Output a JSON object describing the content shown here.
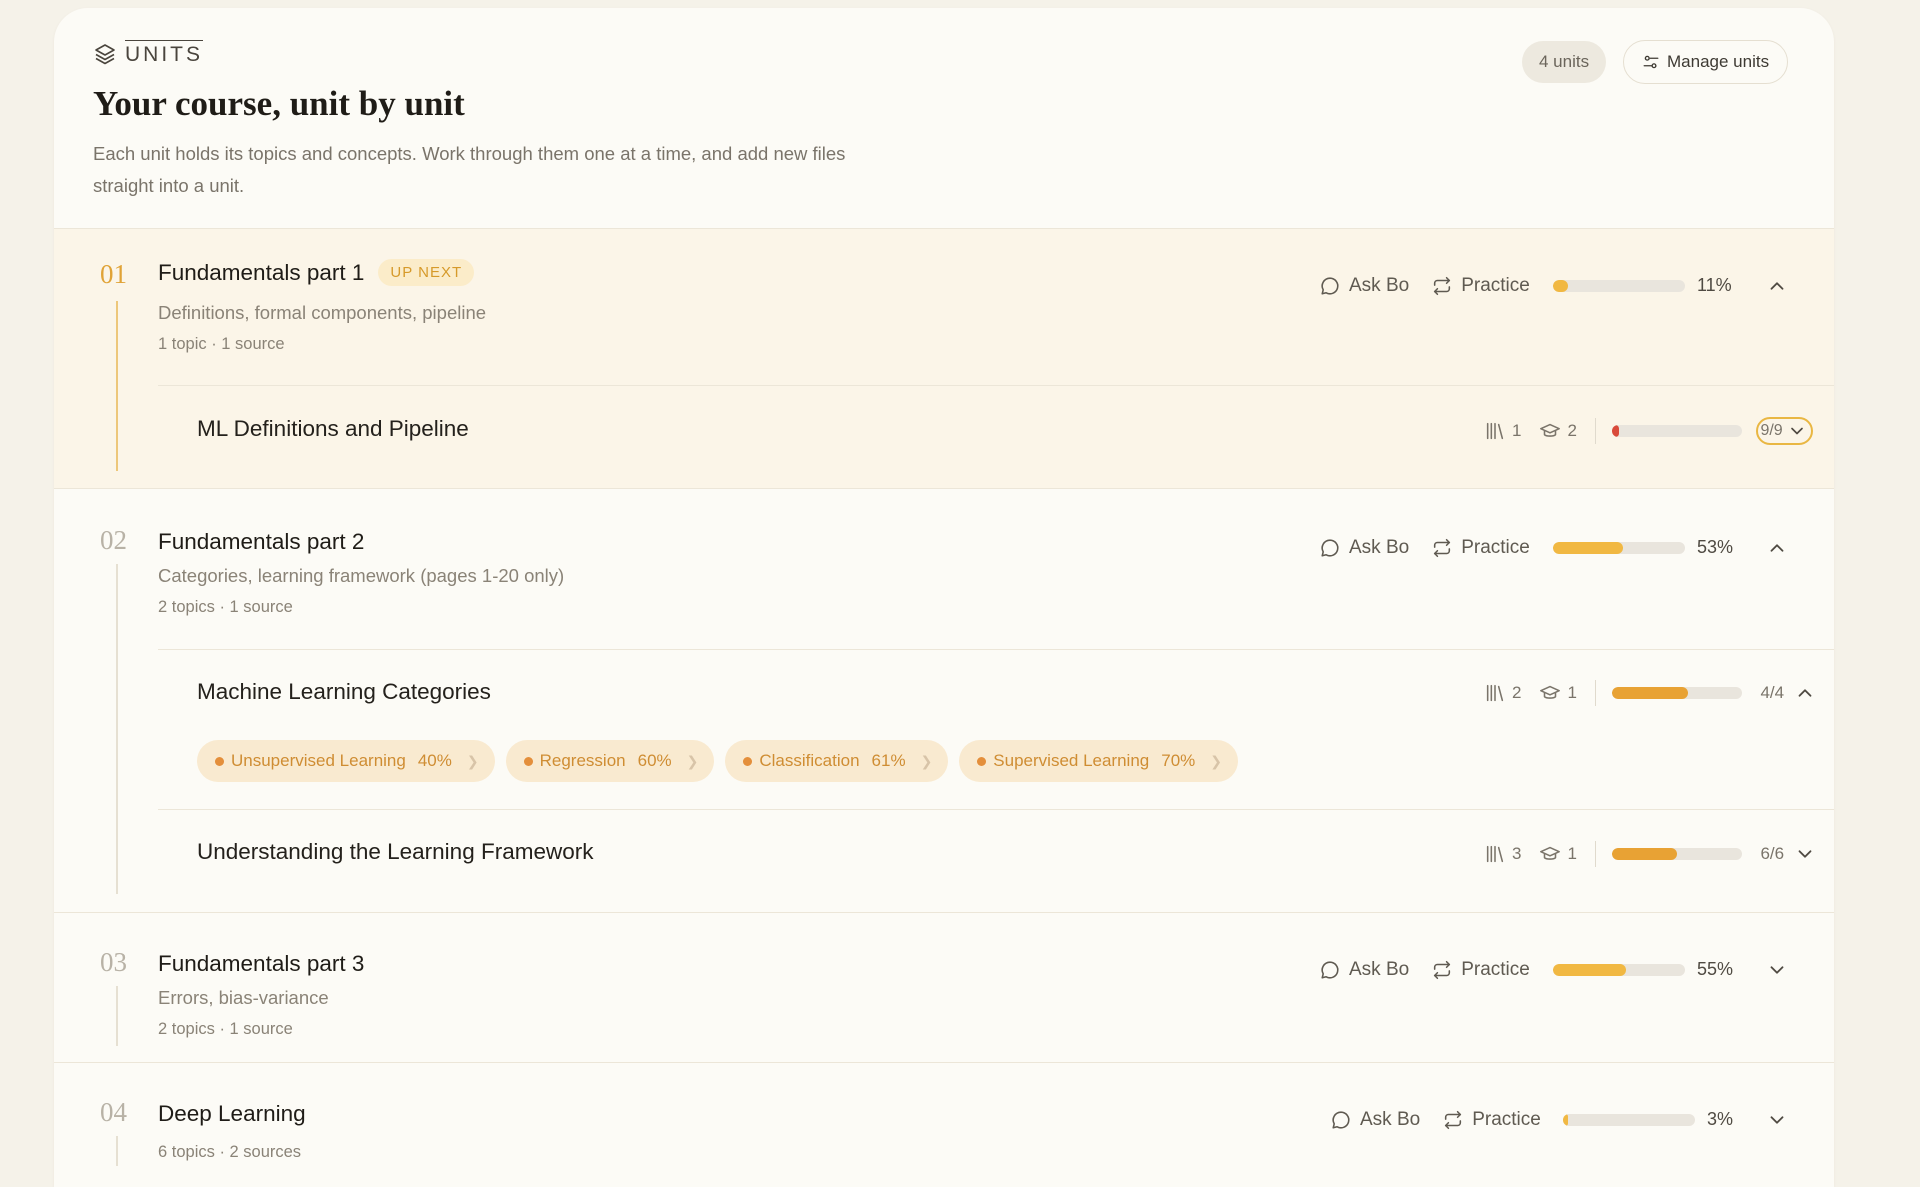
{
  "header": {
    "eyebrow": "UNITS",
    "title": "Your course, unit by unit",
    "description": "Each unit holds its topics and concepts. Work through them one at a time, and add new files straight into a unit.",
    "unit_count": "4 units",
    "manage_label": "Manage units"
  },
  "actions": {
    "ask": "Ask Bo",
    "practice": "Practice"
  },
  "colors": {
    "accent": "#f1b842",
    "accent_dark": "#e0a337",
    "low": "#d94a3a",
    "chip_bg": "#f9ead0",
    "chip_text": "#cf8d33"
  },
  "units": [
    {
      "num": "01",
      "title": "Fundamentals part 1",
      "badge": "UP NEXT",
      "subtitle": "Definitions, formal components, pipeline",
      "meta": "1 topic · 1 source",
      "progress_pct": 11,
      "progress_label": "11%",
      "expanded": true,
      "topics": [
        {
          "name": "ML Definitions and Pipeline",
          "sources": "1",
          "quizzes": "2",
          "progress_pct": 5,
          "fraction": "9/9",
          "expanded": false
        }
      ]
    },
    {
      "num": "02",
      "title": "Fundamentals part 2",
      "subtitle": "Categories, learning framework (pages 1-20 only)",
      "meta": "2 topics · 1 source",
      "progress_pct": 53,
      "progress_label": "53%",
      "expanded": true,
      "topics": [
        {
          "name": "Machine Learning Categories",
          "sources": "2",
          "quizzes": "1",
          "progress_pct": 58,
          "fraction": "4/4",
          "expanded": true,
          "concepts": [
            {
              "name": "Unsupervised Learning",
              "pct": "40%"
            },
            {
              "name": "Regression",
              "pct": "60%"
            },
            {
              "name": "Classification",
              "pct": "61%"
            },
            {
              "name": "Supervised Learning",
              "pct": "70%"
            }
          ]
        },
        {
          "name": "Understanding the Learning Framework",
          "sources": "3",
          "quizzes": "1",
          "progress_pct": 50,
          "fraction": "6/6",
          "expanded": false
        }
      ]
    },
    {
      "num": "03",
      "title": "Fundamentals part 3",
      "subtitle": "Errors, bias-variance",
      "meta": "2 topics · 1 source",
      "progress_pct": 55,
      "progress_label": "55%",
      "expanded": false
    },
    {
      "num": "04",
      "title": "Deep Learning",
      "meta": "6 topics · 2 sources",
      "progress_pct": 3,
      "progress_label": "3%",
      "expanded": false
    }
  ]
}
